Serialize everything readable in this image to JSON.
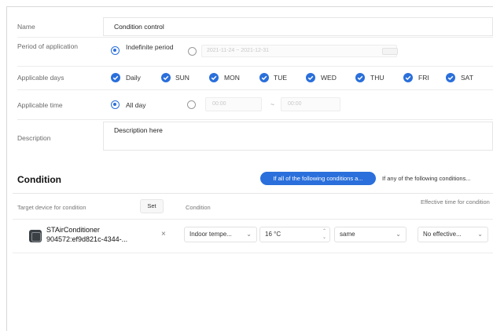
{
  "form": {
    "name": {
      "label": "Name",
      "value": "Condition control"
    },
    "period": {
      "label": "Period of application",
      "indefinite_label": "Indefinite period",
      "range_value": "2021-11-24 ~ 2021-12-31"
    },
    "days": {
      "label": "Applicable days",
      "items": [
        "Daily",
        "SUN",
        "MON",
        "TUE",
        "WED",
        "THU",
        "FRI",
        "SAT"
      ]
    },
    "time": {
      "label": "Applicable time",
      "allday_label": "All day",
      "start": "00:00",
      "separator": "~",
      "end": "00:00"
    },
    "description": {
      "label": "Description",
      "placeholder": "Description here"
    }
  },
  "condition_section": {
    "title": "Condition",
    "mode_all": "If all of the following conditions a...",
    "mode_any": "If any of the following conditions..."
  },
  "table": {
    "headers": {
      "target": "Target device for condition",
      "set_button": "Set",
      "condition": "Condition",
      "effective_time": "Effective time for condition"
    },
    "rows": [
      {
        "device_name": "STAirConditioner",
        "device_id": "904572:ef9d821c-4344-...",
        "remove": "×",
        "condition_type": "Indoor tempe...",
        "value": "16 °C",
        "operator": "same",
        "effective_time": "No effective..."
      }
    ]
  },
  "colors": {
    "accent": "#2a6fdb"
  }
}
